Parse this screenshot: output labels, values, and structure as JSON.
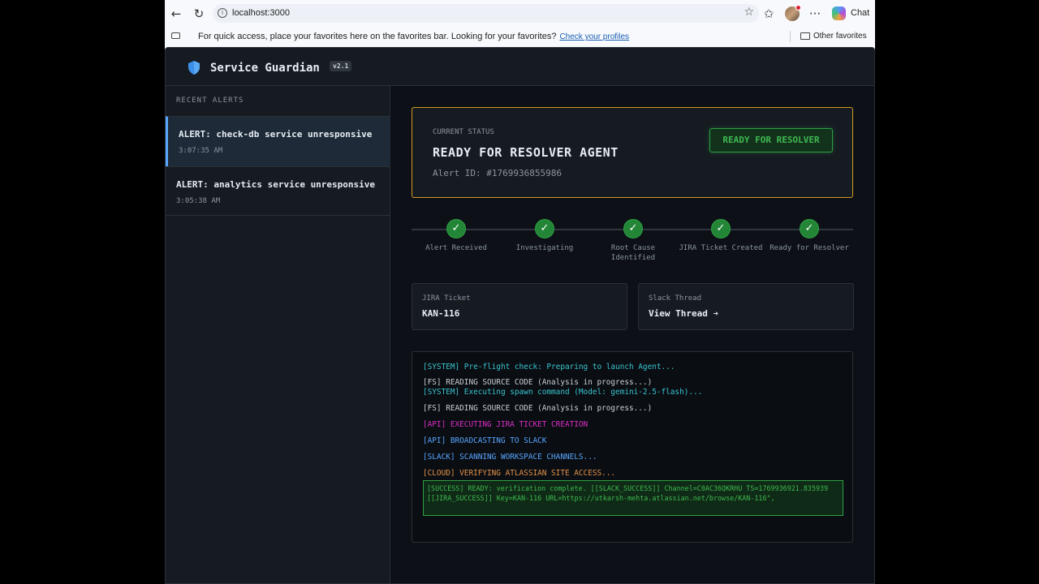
{
  "browser": {
    "url": "localhost:3000",
    "chat_label": "Chat",
    "favorites_message": "For quick access, place your favorites here on the favorites bar. Looking for your favorites?",
    "favorites_link": "Check your profiles",
    "other_favorites": "Other favorites"
  },
  "app": {
    "title": "Service Guardian",
    "version": "v2.1"
  },
  "sidebar": {
    "title": "RECENT ALERTS",
    "alerts": [
      {
        "title": "ALERT: check-db service unresponsive",
        "time": "3:07:35 AM",
        "active": true
      },
      {
        "title": "ALERT: analytics service unresponsive",
        "time": "3:05:38 AM",
        "active": false
      }
    ]
  },
  "status": {
    "label": "CURRENT STATUS",
    "headline": "READY FOR RESOLVER AGENT",
    "alert_id": "Alert ID: #1769936855986",
    "badge": "READY FOR RESOLVER"
  },
  "steps": [
    {
      "label": "Alert Received",
      "check": "✓"
    },
    {
      "label": "Investigating",
      "check": "✓"
    },
    {
      "label": "Root Cause Identified",
      "check": "✓"
    },
    {
      "label": "JIRA Ticket Created",
      "check": "✓"
    },
    {
      "label": "Ready for Resolver",
      "check": "✓"
    }
  ],
  "jira": {
    "label": "JIRA Ticket",
    "value": "KAN-116"
  },
  "slack": {
    "label": "Slack Thread",
    "value": "View Thread ➔"
  },
  "console": {
    "lines": [
      "[SYSTEM] Pre-flight check: Preparing to launch Agent...",
      "[FS] READING SOURCE CODE (Analysis in progress...)",
      "[SYSTEM] Executing spawn command (Model: gemini-2.5-flash)...",
      "[FS] READING SOURCE CODE (Analysis in progress...)",
      "[API] EXECUTING JIRA TICKET CREATION",
      "[API] BROADCASTING TO SLACK",
      "[SLACK] SCANNING WORKSPACE CHANNELS...",
      "[CLOUD] VERIFYING ATLASSIAN SITE ACCESS..."
    ],
    "success": "[SUCCESS] READY: verification complete. [[SLACK_SUCCESS]] Channel=C0AC36QKRHU TS=1769936921.835939 [[JIRA_SUCCESS]] Key=KAN-116 URL=https://utkarsh-mehta.atlassian.net/browse/KAN-116\","
  },
  "colors": {
    "accent": "#58a6ff",
    "success": "#3fb950",
    "warning_border": "#d29922",
    "background": "#0d1117"
  }
}
